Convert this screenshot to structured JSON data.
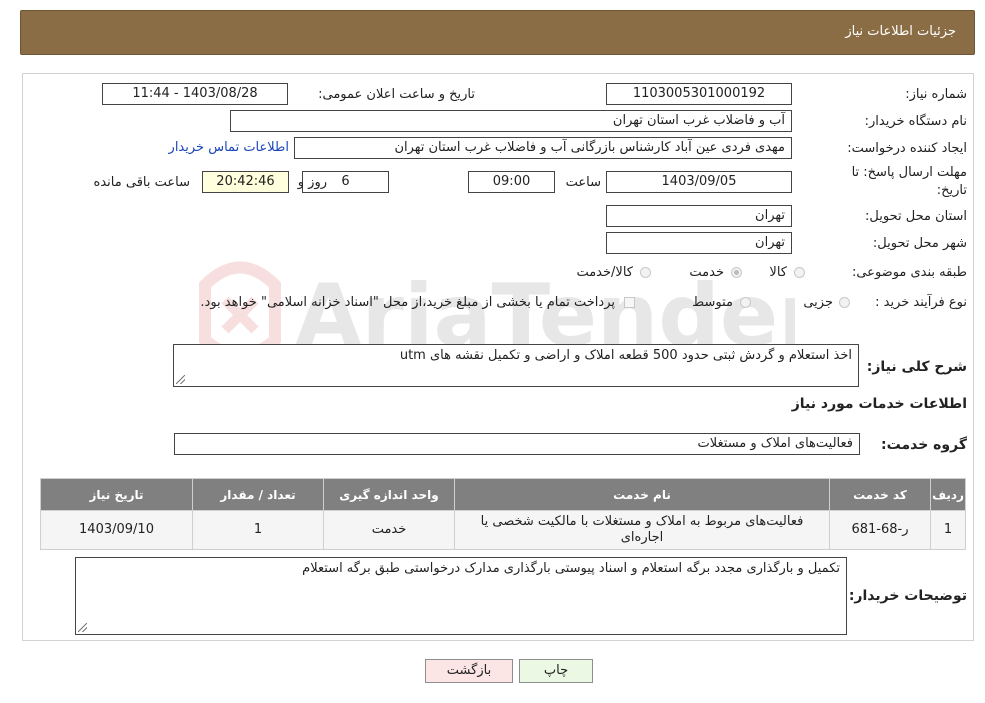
{
  "header": {
    "title": "جزئیات اطلاعات نیاز"
  },
  "form": {
    "need_number_label": "شماره نیاز:",
    "need_number": "1103005301000192",
    "announce_label": "تاریخ و ساعت اعلان عمومی:",
    "announce_value": "1403/08/28 - 11:44",
    "buyer_org_label": "نام دستگاه خریدار:",
    "buyer_org": "آب و فاضلاب غرب استان تهران",
    "creator_label": "ایجاد کننده درخواست:",
    "creator": "مهدی فردی عین آباد کارشناس بازرگانی آب و فاضلاب غرب استان تهران",
    "contact_link": "اطلاعات تماس خریدار",
    "deadline_label_1": "مهلت ارسال پاسخ: تا",
    "deadline_label_2": "تاریخ:",
    "deadline_date": "1403/09/05",
    "time_label": "ساعت",
    "deadline_time": "09:00",
    "days_value": "6",
    "days_label": "روز و",
    "remaining_time": "20:42:46",
    "remaining_label": "ساعت باقی مانده",
    "delivery_province_label": "استان محل تحویل:",
    "delivery_province": "تهران",
    "delivery_city_label": "شهر محل تحویل:",
    "delivery_city": "تهران",
    "category_label": "طبقه بندی موضوعی:",
    "category_options": [
      "کالا",
      "خدمت",
      "کالا/خدمت"
    ],
    "process_label": "نوع فرآیند خرید :",
    "process_options": [
      "جزیی",
      "متوسط"
    ],
    "payment_note": "پرداخت تمام یا بخشی از مبلغ خرید،از محل \"اسناد خزانه اسلامی\" خواهد بود."
  },
  "summary": {
    "label": "شرح کلی نیاز:",
    "text": "اخذ استعلام و گردش ثبتی حدود 500 قطعه املاک و اراضی و تکمیل نقشه های  utm"
  },
  "services": {
    "section_title": "اطلاعات خدمات مورد نیاز",
    "group_label": "گروه خدمت:",
    "group_value": "فعالیت‌های  املاک و مستغلات",
    "columns": [
      "ردیف",
      "کد خدمت",
      "نام خدمت",
      "واحد اندازه گیری",
      "تعداد / مقدار",
      "تاریخ نیاز"
    ],
    "rows": [
      {
        "index": "1",
        "code": "ر-68-681",
        "name": "فعالیت‌های مربوط به املاک و مستغلات با مالکیت شخصی یا اجاره‌ای",
        "unit": "خدمت",
        "qty": "1",
        "date": "1403/09/10"
      }
    ]
  },
  "buyer_notes": {
    "label": "توضیحات خریدار:",
    "text": "تکمیل و بارگذاری مجدد برگه استعلام و اسناد پیوستی   بارگذاری مدارک درخواستی طبق برگه استعلام"
  },
  "buttons": {
    "print": "چاپ",
    "back": "بازگشت"
  },
  "colors": {
    "header_bg": "#8b6d45",
    "table_header_bg": "#808080",
    "link": "#1a47b8"
  }
}
